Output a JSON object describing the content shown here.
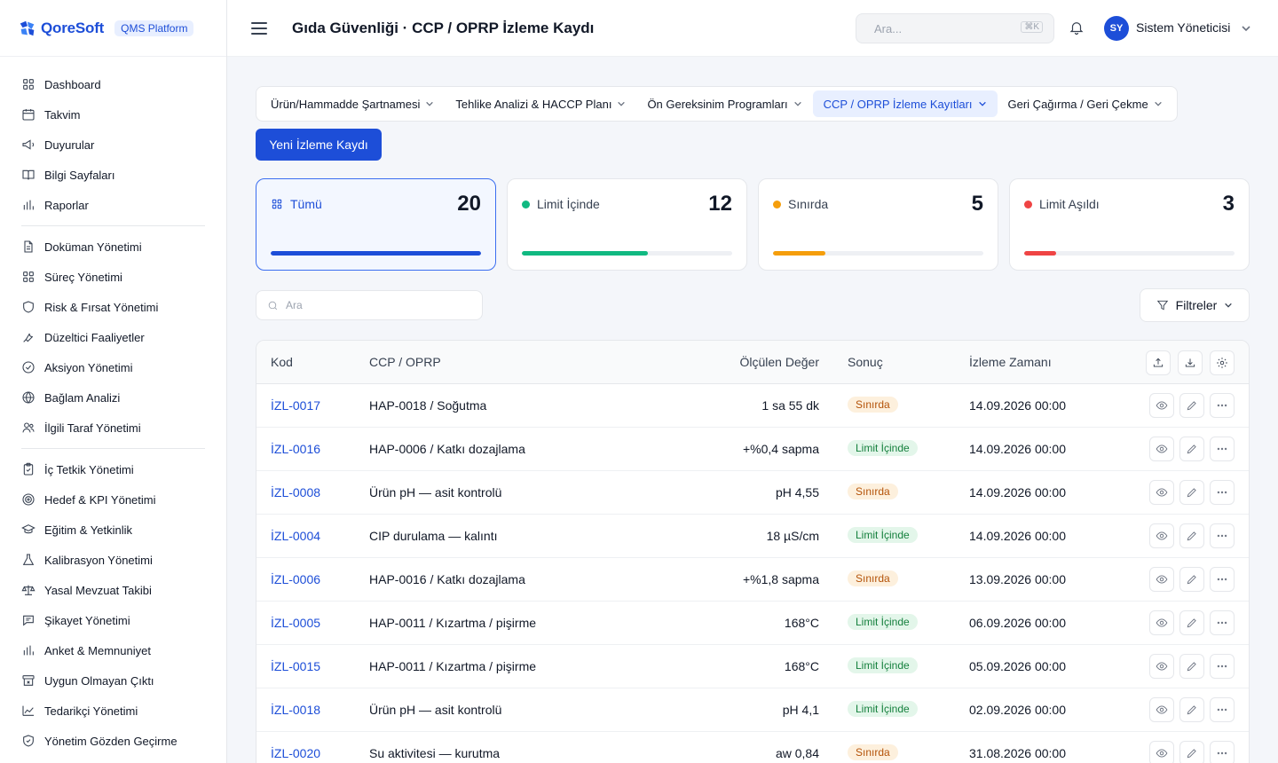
{
  "brand": {
    "name": "QoreSoft",
    "badge": "QMS Platform",
    "accent": "#1d4ed8"
  },
  "header": {
    "title": "Gıda Güvenliği · CCP / OPRP İzleme Kaydı",
    "search_placeholder": "Ara...",
    "search_shortcut": "⌘K",
    "user_initials": "SY",
    "user_name": "Sistem Yöneticisi"
  },
  "sidebar": {
    "groups": [
      [
        {
          "label": "Dashboard",
          "icon": "grid-icon"
        },
        {
          "label": "Takvim",
          "icon": "calendar-icon"
        },
        {
          "label": "Duyurular",
          "icon": "megaphone-icon"
        },
        {
          "label": "Bilgi Sayfaları",
          "icon": "book-icon"
        },
        {
          "label": "Raporlar",
          "icon": "bar-chart-icon"
        }
      ],
      [
        {
          "label": "Doküman Yönetimi",
          "icon": "document-icon"
        },
        {
          "label": "Süreç Yönetimi",
          "icon": "grid-icon"
        },
        {
          "label": "Risk & Fırsat Yönetimi",
          "icon": "shield-icon"
        },
        {
          "label": "Düzeltici Faaliyetler",
          "icon": "wrench-icon"
        },
        {
          "label": "Aksiyon Yönetimi",
          "icon": "check-circle-icon"
        },
        {
          "label": "Bağlam Analizi",
          "icon": "globe-icon"
        },
        {
          "label": "İlgili Taraf Yönetimi",
          "icon": "users-icon"
        }
      ],
      [
        {
          "label": "İç Tetkik Yönetimi",
          "icon": "clipboard-icon"
        },
        {
          "label": "Hedef & KPI Yönetimi",
          "icon": "target-icon"
        },
        {
          "label": "Eğitim & Yetkinlik",
          "icon": "graduation-cap-icon"
        },
        {
          "label": "Kalibrasyon Yönetimi",
          "icon": "flask-icon"
        },
        {
          "label": "Yasal Mevzuat Takibi",
          "icon": "scale-icon"
        },
        {
          "label": "Şikayet Yönetimi",
          "icon": "message-icon"
        },
        {
          "label": "Anket & Memnuniyet",
          "icon": "bar-chart-icon"
        },
        {
          "label": "Uygun Olmayan Çıktı",
          "icon": "archive-x-icon"
        },
        {
          "label": "Tedarikçi Yönetimi",
          "icon": "line-chart-icon"
        },
        {
          "label": "Yönetim Gözden Geçirme",
          "icon": "shield-check-icon"
        }
      ]
    ]
  },
  "module_tabs": [
    {
      "label": "Ürün/Hammadde Şartnamesi",
      "active": false
    },
    {
      "label": "Tehlike Analizi & HACCP Planı",
      "active": false
    },
    {
      "label": "Ön Gereksinim Programları",
      "active": false
    },
    {
      "label": "CCP / OPRP İzleme Kayıtları",
      "active": true
    },
    {
      "label": "Geri Çağırma / Geri Çekme",
      "active": false
    }
  ],
  "new_button": "Yeni İzleme Kaydı",
  "stats": [
    {
      "label": "Tümü",
      "count": "20",
      "fraction": 1.0,
      "color": "#1d4ed8",
      "active": true
    },
    {
      "label": "Limit İçinde",
      "count": "12",
      "fraction": 0.6,
      "color": "#10b981",
      "active": false
    },
    {
      "label": "Sınırda",
      "count": "5",
      "fraction": 0.25,
      "color": "#f59e0b",
      "active": false
    },
    {
      "label": "Limit Aşıldı",
      "count": "3",
      "fraction": 0.15,
      "color": "#ef4444",
      "active": false
    }
  ],
  "table_search_placeholder": "Ara",
  "filters_label": "Filtreler",
  "table": {
    "columns": [
      "Kod",
      "CCP / OPRP",
      "Ölçülen Değer",
      "Sonuç",
      "İzleme Zamanı"
    ],
    "rows": [
      {
        "code": "İZL-0017",
        "ccp": "HAP-0018 / Soğutma",
        "value": "1 sa 55 dk",
        "result": "Sınırda",
        "time": "14.09.2026 00:00"
      },
      {
        "code": "İZL-0016",
        "ccp": "HAP-0006 / Katkı dozajlama",
        "value": "+%0,4 sapma",
        "result": "Limit İçinde",
        "time": "14.09.2026 00:00"
      },
      {
        "code": "İZL-0008",
        "ccp": "Ürün pH — asit kontrolü",
        "value": "pH 4,55",
        "result": "Sınırda",
        "time": "14.09.2026 00:00"
      },
      {
        "code": "İZL-0004",
        "ccp": "CIP durulama — kalıntı",
        "value": "18 µS/cm",
        "result": "Limit İçinde",
        "time": "14.09.2026 00:00"
      },
      {
        "code": "İZL-0006",
        "ccp": "HAP-0016 / Katkı dozajlama",
        "value": "+%1,8 sapma",
        "result": "Sınırda",
        "time": "13.09.2026 00:00"
      },
      {
        "code": "İZL-0005",
        "ccp": "HAP-0011 / Kızartma / pişirme",
        "value": "168°C",
        "result": "Limit İçinde",
        "time": "06.09.2026 00:00"
      },
      {
        "code": "İZL-0015",
        "ccp": "HAP-0011 / Kızartma / pişirme",
        "value": "168°C",
        "result": "Limit İçinde",
        "time": "05.09.2026 00:00"
      },
      {
        "code": "İZL-0018",
        "ccp": "Ürün pH — asit kontrolü",
        "value": "pH 4,1",
        "result": "Limit İçinde",
        "time": "02.09.2026 00:00"
      },
      {
        "code": "İZL-0020",
        "ccp": "Su aktivitesi — kurutma",
        "value": "aw 0,84",
        "result": "Sınırda",
        "time": "31.08.2026 00:00"
      }
    ]
  }
}
